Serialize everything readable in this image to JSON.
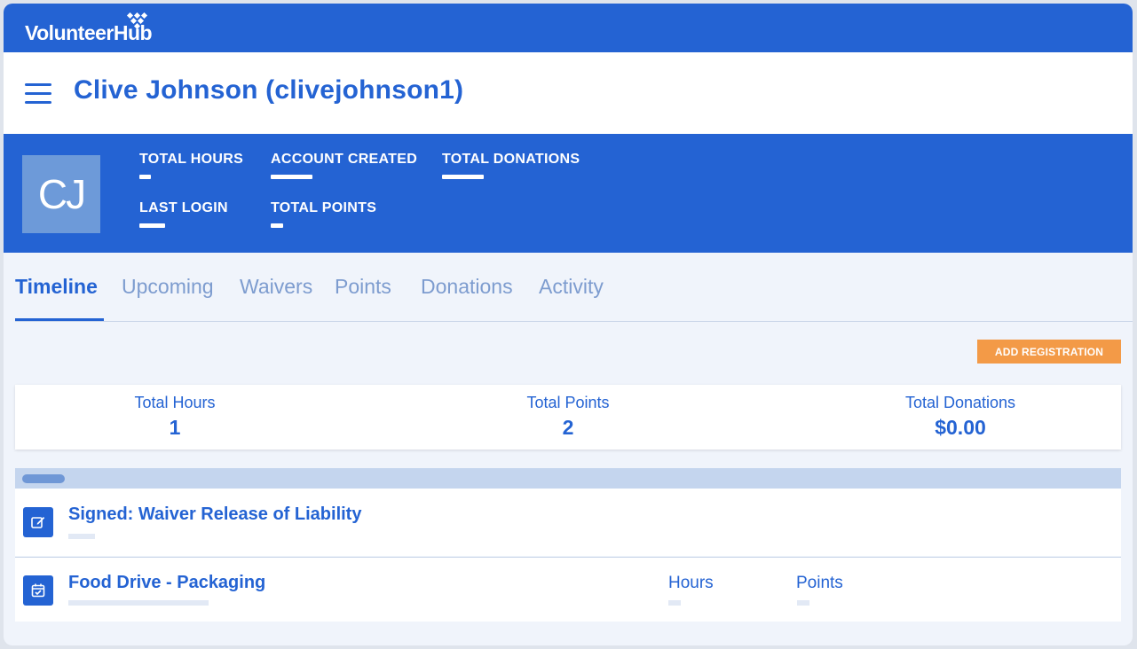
{
  "app": {
    "logo_text": "VolunteerHub"
  },
  "header": {
    "page_title": "Clive Johnson (clivejohnson1)"
  },
  "profile": {
    "initials": "CJ",
    "stats": {
      "total_hours_label": "TOTAL HOURS",
      "account_created_label": "ACCOUNT CREATED",
      "total_donations_label": "TOTAL DONATIONS",
      "last_login_label": "LAST LOGIN",
      "total_points_label": "TOTAL POINTS"
    }
  },
  "tabs": [
    {
      "label": "Timeline",
      "active": true
    },
    {
      "label": "Upcoming"
    },
    {
      "label": "Waivers"
    },
    {
      "label": "Points"
    },
    {
      "label": "Donations"
    },
    {
      "label": "Activity"
    }
  ],
  "actions": {
    "add_registration": "ADD REGISTRATION"
  },
  "summary": {
    "hours_label": "Total Hours",
    "hours_value": "1",
    "points_label": "Total Points",
    "points_value": "2",
    "donations_label": "Total Donations",
    "donations_value": "$0.00"
  },
  "timeline": {
    "items": [
      {
        "title": "Signed: Waiver Release of Liability",
        "icon": "edit-icon"
      },
      {
        "title": "Food Drive - Packaging",
        "icon": "calendar-check-icon",
        "hours_label": "Hours",
        "points_label": "Points"
      }
    ]
  },
  "colors": {
    "primary": "#2463d3",
    "accent": "#f39a47",
    "avatar_bg": "#6d9ad9",
    "background": "#f0f4fb"
  }
}
